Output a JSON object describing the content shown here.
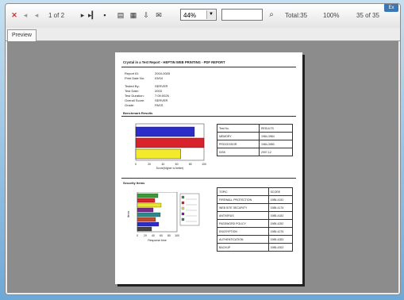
{
  "toolbar": {
    "page_indicator": "1 of 2",
    "zoom": "44%",
    "total_label": "Total:35",
    "percent_label": "100%",
    "count_label": "35 of 35",
    "exit_label": "Ex"
  },
  "tabs": [
    {
      "label": "Preview"
    }
  ],
  "report": {
    "title": "Crystal in a Test Report - HEPTIN WEB PRINTING - PDF REPORT",
    "info_rows": [
      {
        "label": "Report ID:",
        "value": "2004-0005"
      },
      {
        "label": "Print Date No:",
        "value": "03/04"
      },
      {
        "label": "Tested By:",
        "value": "SERVER"
      },
      {
        "label": "Test Date:",
        "value": "2003"
      },
      {
        "label": "Test Duration:",
        "value": "7:09:0026"
      },
      {
        "label": "Overall Score:",
        "value": "SERVER"
      },
      {
        "label": "Grade:",
        "value": "PASS"
      }
    ],
    "section1_label": "Benchmark Results",
    "chart1": {
      "xlabel": "Score(higher is better)",
      "ticks": [
        "0",
        "20",
        "40",
        "60",
        "80",
        "100"
      ],
      "bars": [
        {
          "color": "#2c2cc9",
          "value": 86
        },
        {
          "color": "#d8222c",
          "value": 100
        },
        {
          "color": "#f2ea2a",
          "value": 66
        }
      ]
    },
    "table1": [
      [
        "Test No.",
        "RESULTS"
      ],
      [
        "MEMORY",
        "1984-3984"
      ],
      [
        "PROCESSOR",
        "1984-3980"
      ],
      [
        "DISK",
        "2007-12"
      ]
    ],
    "section2_label": "Security Items",
    "chart2": {
      "ticks": [
        "0",
        "20",
        "40",
        "60",
        "80",
        "100"
      ],
      "xlabel": "Response time",
      "ylabel": "Items",
      "bars": [
        {
          "color": "#3a9a3a",
          "value": 52
        },
        {
          "color": "#d8222c",
          "value": 44
        },
        {
          "color": "#e9e52c",
          "value": 60
        },
        {
          "color": "#7a2a8a",
          "value": 40
        },
        {
          "color": "#2c8a8a",
          "value": 58
        },
        {
          "color": "#c04a2c",
          "value": 46
        },
        {
          "color": "#2c2cc9",
          "value": 54
        },
        {
          "color": "#444444",
          "value": 36
        }
      ],
      "legend": [
        "",
        "",
        "",
        "",
        ""
      ]
    },
    "table2": [
      [
        "TOPIC",
        "SCORE"
      ],
      [
        "FIREWALL PROTECTION",
        "1985-4152"
      ],
      [
        "WEB SITE SECURITY",
        "1985-4176"
      ],
      [
        "ANTIVIRUS",
        "1985-4182"
      ],
      [
        "PASSWORD POLICY",
        "1985-4252"
      ],
      [
        "ENCRYPTION",
        "1985-4276"
      ],
      [
        "AUTHENTICATION",
        "1985-4283"
      ],
      [
        "BACKUP",
        "1985-4302"
      ]
    ]
  }
}
